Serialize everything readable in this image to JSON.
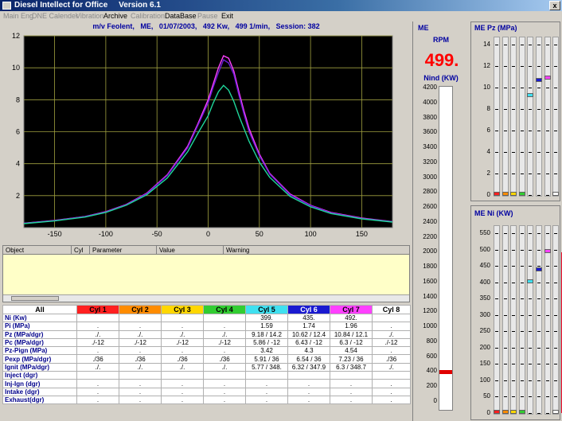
{
  "window": {
    "title": "Diesel Intellect for Office     Version 6.1",
    "close": "x"
  },
  "menu": [
    {
      "label": "Main Eng",
      "enabled": false
    },
    {
      "label": "DNE Calender",
      "enabled": false
    },
    {
      "label": "Vibration",
      "enabled": false
    },
    {
      "label": "Archive",
      "enabled": true
    },
    {
      "label": "Calibration",
      "enabled": false
    },
    {
      "label": "DataBase",
      "enabled": true
    },
    {
      "label": "Pause",
      "enabled": false
    },
    {
      "label": "Exit",
      "enabled": true
    }
  ],
  "chart_header": "m/v Feolent,   ME,   01/07/2003,   492 Kw,   499 1/min,   Session: 382",
  "chart_data": {
    "type": "line",
    "ylim": [
      0,
      12
    ],
    "xlim": [
      -180,
      180
    ],
    "y_ticks": [
      "12",
      "10",
      "8",
      "6",
      "4",
      "2"
    ],
    "x_ticks": [
      "-150",
      "-100",
      "-50",
      "0",
      "50",
      "100",
      "150"
    ],
    "grid": true,
    "series": [
      {
        "color": "#ff40ff",
        "x": [
          -180,
          -150,
          -120,
          -100,
          -80,
          -60,
          -40,
          -20,
          -10,
          0,
          5,
          10,
          15,
          20,
          25,
          30,
          35,
          40,
          50,
          60,
          80,
          100,
          120,
          150,
          180
        ],
        "y": [
          0.28,
          0.45,
          0.7,
          1.0,
          1.45,
          2.15,
          3.3,
          5.1,
          6.5,
          8.0,
          9.0,
          10.0,
          10.75,
          10.6,
          9.8,
          8.5,
          7.3,
          6.2,
          4.6,
          3.4,
          2.1,
          1.4,
          0.95,
          0.6,
          0.38
        ]
      },
      {
        "color": "#6a1ed6",
        "x": [
          -180,
          -150,
          -120,
          -100,
          -80,
          -60,
          -40,
          -20,
          -10,
          0,
          5,
          10,
          15,
          20,
          25,
          30,
          35,
          40,
          50,
          60,
          80,
          100,
          120,
          150,
          180
        ],
        "y": [
          0.27,
          0.44,
          0.69,
          0.98,
          1.43,
          2.12,
          3.25,
          5.0,
          6.4,
          7.8,
          8.8,
          9.7,
          10.5,
          10.3,
          9.6,
          8.3,
          7.1,
          6.0,
          4.5,
          3.35,
          2.05,
          1.38,
          0.92,
          0.58,
          0.37
        ]
      },
      {
        "color": "#1fd69a",
        "x": [
          -180,
          -150,
          -120,
          -100,
          -80,
          -60,
          -40,
          -20,
          -10,
          0,
          5,
          10,
          15,
          20,
          25,
          30,
          35,
          40,
          50,
          60,
          80,
          100,
          120,
          150,
          180
        ],
        "y": [
          0.25,
          0.42,
          0.66,
          0.95,
          1.4,
          2.05,
          3.1,
          4.75,
          5.9,
          7.0,
          7.8,
          8.5,
          8.9,
          8.6,
          7.9,
          7.0,
          6.2,
          5.4,
          4.1,
          3.15,
          1.95,
          1.3,
          0.88,
          0.55,
          0.35
        ]
      }
    ]
  },
  "messages": {
    "columns": [
      "Object",
      "Cyl",
      "Parameter",
      "Value",
      "Warning"
    ]
  },
  "table": {
    "headers": [
      {
        "label": "All",
        "color": "#ffffff"
      },
      {
        "label": "Cyl 1",
        "color": "#ff2020"
      },
      {
        "label": "Cyl 2",
        "color": "#ff8c00"
      },
      {
        "label": "Cyl 3",
        "color": "#ffd700"
      },
      {
        "label": "Cyl 4",
        "color": "#32cd32"
      },
      {
        "label": "Cyl 5",
        "color": "#40e0f0"
      },
      {
        "label": "Cyl 6",
        "color": "#1a1ad0"
      },
      {
        "label": "Cyl 7",
        "color": "#ff40ff"
      },
      {
        "label": "Cyl 8",
        "color": "#ffffff"
      }
    ],
    "rows": [
      {
        "label": "Ni    (Kw)",
        "cells": [
          "",
          "",
          "",
          "",
          "399.",
          "435.",
          "492.",
          ""
        ]
      },
      {
        "label": "Pi    (MPa)",
        "cells": [
          ".",
          ".",
          ".",
          ".",
          "1.59",
          "1.74",
          "1.96",
          "."
        ]
      },
      {
        "label": "Pz      (MPa/dgr)",
        "cells": [
          "./.",
          "./.",
          "./.",
          "./.",
          "9.18 / 14.2",
          "10.62 / 12.4",
          "10.84 / 12.1",
          "./."
        ]
      },
      {
        "label": "Pc      (MPa/dgr)",
        "cells": [
          "./-12",
          "./-12",
          "./-12",
          "./-12",
          "5.86 / -12",
          "6.43 / -12",
          "6.3 / -12",
          "./-12"
        ]
      },
      {
        "label": "Pz-Pign    (MPa)",
        "cells": [
          ".",
          ".",
          ".",
          ".",
          "3.42",
          "4.3",
          "4.54",
          "."
        ]
      },
      {
        "label": "Pexp   (MPa/dgr)",
        "cells": [
          "./36",
          "./36",
          "./36",
          "./36",
          "5.91 / 36",
          "6.54 / 36",
          "7.23 / 36",
          "./36"
        ]
      },
      {
        "label": "Ignit  (MPa/dgr)",
        "cells": [
          "./.",
          "./.",
          "./.",
          "./.",
          "5.77 / 348.",
          "6.32 / 347.9",
          "6.3 / 348.7",
          "./."
        ]
      },
      {
        "label": "Inject (dgr)",
        "cells": [
          "",
          "",
          "",
          "",
          "",
          "",
          "",
          ""
        ]
      },
      {
        "label": "Inj-Ign  (dgr)",
        "cells": [
          ".",
          ".",
          ".",
          ".",
          ".",
          ".",
          ".",
          "."
        ]
      },
      {
        "label": "Intake (dgr)",
        "cells": [
          ".",
          ".",
          ".",
          ".",
          ".",
          ".",
          ".",
          "."
        ]
      },
      {
        "label": "Exhaust(dgr)",
        "cells": [
          ".",
          ".",
          ".",
          ".",
          ".",
          ".",
          ".",
          "."
        ]
      }
    ]
  },
  "me": {
    "title": "ME",
    "rpm_label": "RPM",
    "rpm_value": "499.",
    "nind_label": "Nind (KW)",
    "nind_value": 492,
    "nind_max": 4200,
    "nind_ticks": [
      "4200",
      "4000",
      "3800",
      "3600",
      "3400",
      "3200",
      "3000",
      "2800",
      "2600",
      "2400",
      "2200",
      "2000",
      "1800",
      "1600",
      "1400",
      "1200",
      "1000",
      "800",
      "600",
      "400",
      "200",
      "0"
    ]
  },
  "pz_panel": {
    "title": "ME Pz  (MPa)",
    "max": 15,
    "ticks": [
      "14",
      "12",
      "10",
      "8",
      "6",
      "4",
      "2",
      "0"
    ],
    "marker_colors": [
      "#ff2020",
      "#ff8c00",
      "#ffd700",
      "#32cd32",
      "#40e0f0",
      "#1a1ad0",
      "#ff40ff",
      "#ffffff"
    ],
    "values": [
      0,
      0,
      0,
      0,
      9.18,
      10.62,
      10.84,
      0
    ]
  },
  "ni_panel": {
    "title": "ME Ni   (KW)",
    "max": 550,
    "ticks": [
      "550",
      "500",
      "450",
      "400",
      "350",
      "300",
      "250",
      "200",
      "150",
      "100",
      "50",
      "0"
    ],
    "marker_colors": [
      "#ff2020",
      "#ff8c00",
      "#ffd700",
      "#32cd32",
      "#40e0f0",
      "#1a1ad0",
      "#ff40ff",
      "#ffffff"
    ],
    "values": [
      0,
      0,
      0,
      0,
      399,
      435,
      492,
      0
    ],
    "all_value": 492
  }
}
